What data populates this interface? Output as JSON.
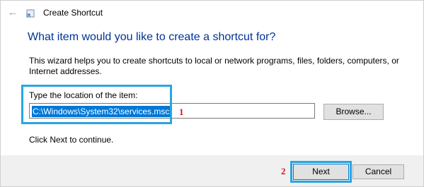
{
  "window": {
    "title": "Create Shortcut",
    "back_icon": "back-arrow-icon",
    "app_icon": "shortcut-icon"
  },
  "wizard": {
    "heading": "What item would you like to create a shortcut for?",
    "description": "This wizard helps you to create shortcuts to local or network programs, files, folders, computers, or Internet addresses.",
    "location_label": "Type the location of the item:",
    "location_value": "C:\\Windows\\System32\\services.msc",
    "browse_label": "Browse...",
    "hint": "Click Next to continue."
  },
  "footer": {
    "next_label": "Next",
    "cancel_label": "Cancel"
  },
  "annotations": {
    "marker_1": "1",
    "marker_2": "2",
    "highlight_color": "#28a6e0",
    "marker_color": "#d31616"
  },
  "colors": {
    "heading": "#003399",
    "selection": "#0078d7",
    "button_face": "#e1e1e1",
    "footer_band": "#f0f0f0"
  }
}
